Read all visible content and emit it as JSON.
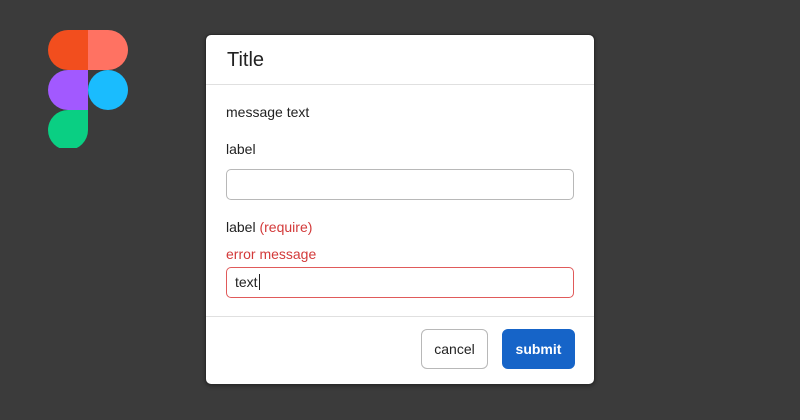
{
  "dialog": {
    "title": "Title",
    "message": "message text",
    "field1": {
      "label": "label",
      "value": ""
    },
    "field2": {
      "label": "label",
      "require_text": "(require)",
      "error_message": "error message",
      "value": "text"
    },
    "buttons": {
      "cancel": "cancel",
      "submit": "submit"
    }
  },
  "colors": {
    "background": "#3b3b3b",
    "primary": "#1664c8",
    "error": "#d33a3a"
  },
  "icons": {
    "logo": "figma-logo-icon"
  }
}
